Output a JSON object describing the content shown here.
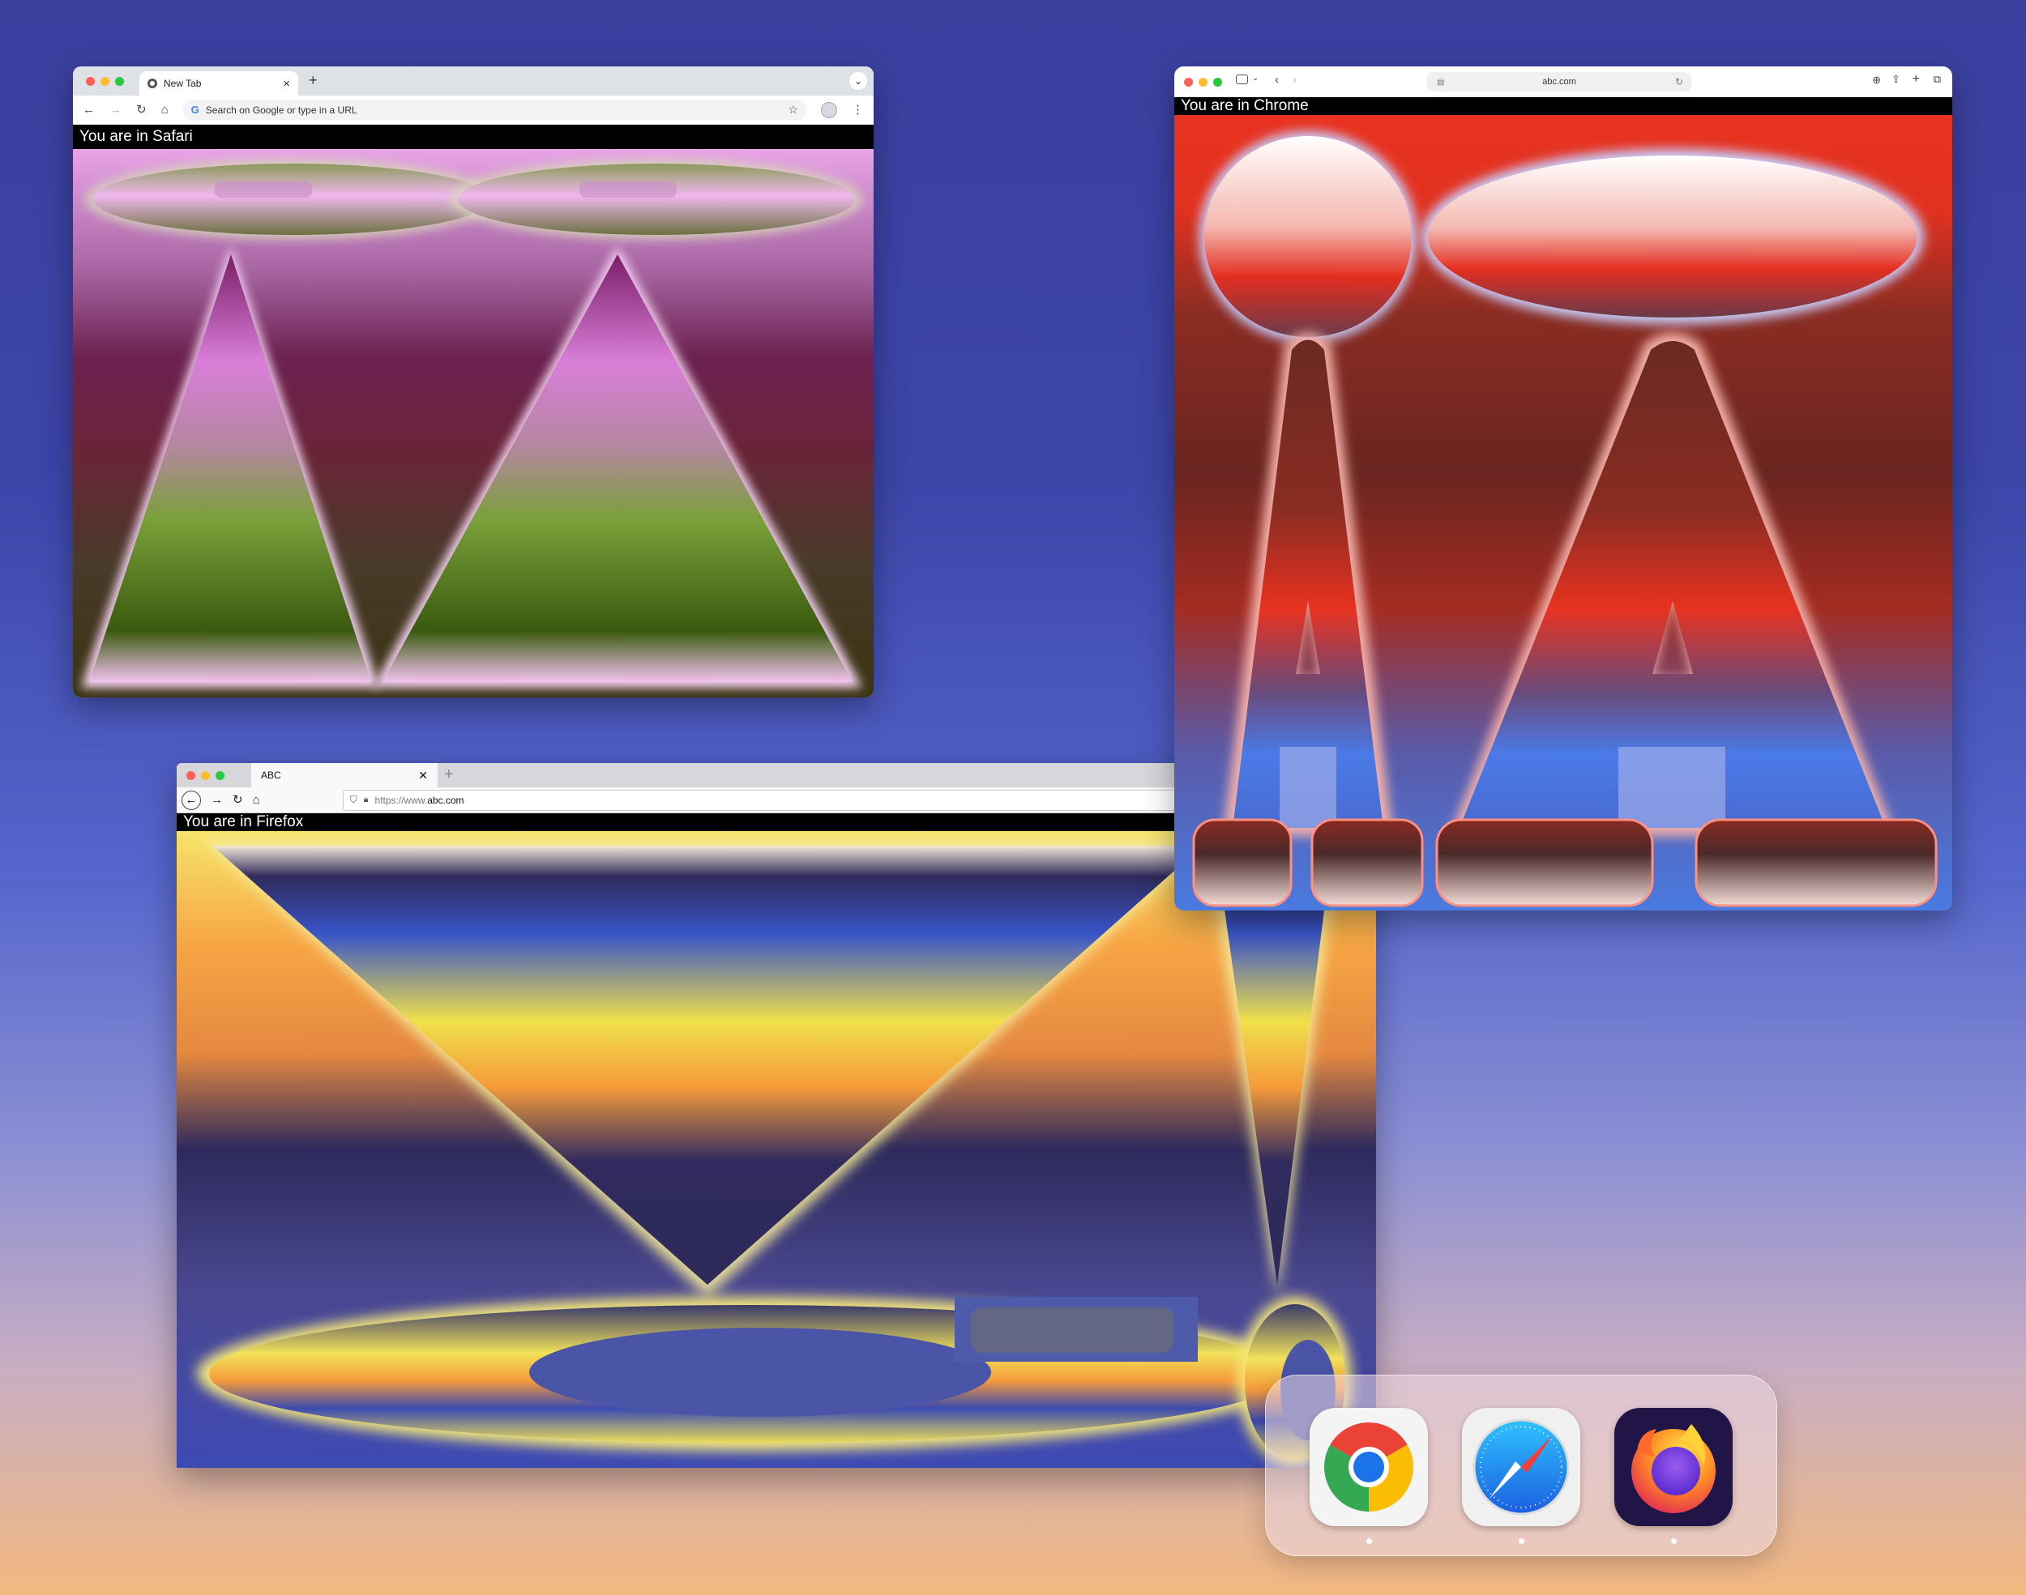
{
  "chrome_window": {
    "tab_title": "New Tab",
    "omnibox_placeholder": "Search on Google or type in a URL",
    "banner": "You are in Safari",
    "new_tab_symbol": "+",
    "tab_close_symbol": "×"
  },
  "safari_window": {
    "address": "abc.com",
    "banner": "You are in Chrome"
  },
  "firefox_window": {
    "tab_title": "ABC",
    "url_prefix": "https://www.",
    "url_domain": "abc.com",
    "banner": "You are in Firefox",
    "tab_close_symbol": "✕",
    "new_tab_symbol": "+"
  },
  "dock": {
    "apps": [
      {
        "name": "Google Chrome",
        "icon": "chrome-icon",
        "running": true
      },
      {
        "name": "Safari",
        "icon": "safari-compass-icon",
        "running": true
      },
      {
        "name": "Firefox",
        "icon": "firefox-icon",
        "running": true
      }
    ]
  },
  "colors": {
    "chrome_art": [
      "#e6a1e6",
      "#9a3c8a",
      "#5e1c3a",
      "#7aa03a",
      "#3a4a10"
    ],
    "safari_art": [
      "#ffffff",
      "#e8321f",
      "#7a2a1f",
      "#4a7fe6"
    ],
    "firefox_art": [
      "#f4e455",
      "#f59a3b",
      "#2e2a5e",
      "#3f49b7"
    ]
  }
}
